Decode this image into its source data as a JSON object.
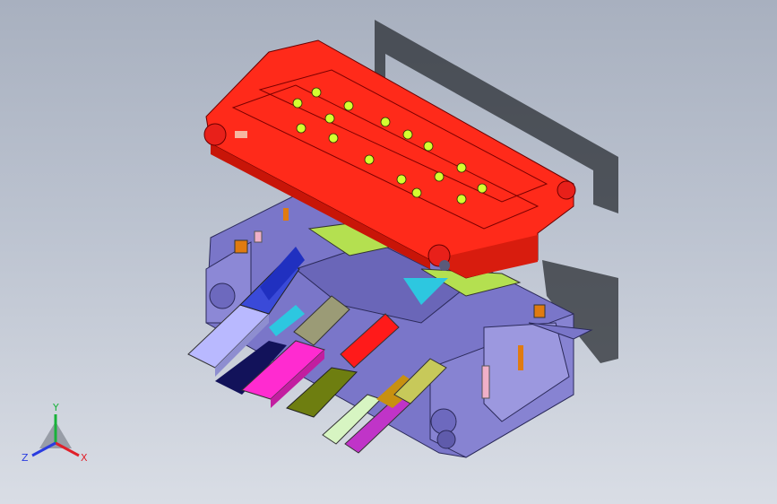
{
  "viewport": {
    "background_top": "#a8b0bf",
    "background_bottom": "#d9dde5"
  },
  "model": {
    "upper_die_color": "#ff2a1a",
    "lower_die_color": "#7a76c9",
    "part_colors": [
      "#3a4ad8",
      "#ff2bd0",
      "#ff1a1a",
      "#b9b9ff",
      "#6e7e10",
      "#c034c8",
      "#d7f5c2",
      "#9b9b76",
      "#ffd84a",
      "#2dc7e0"
    ]
  },
  "triad": {
    "x_label": "X",
    "y_label": "Y",
    "z_label": "Z",
    "x_color": "#e0202a",
    "y_color": "#18b23a",
    "z_color": "#2a3ce0"
  }
}
